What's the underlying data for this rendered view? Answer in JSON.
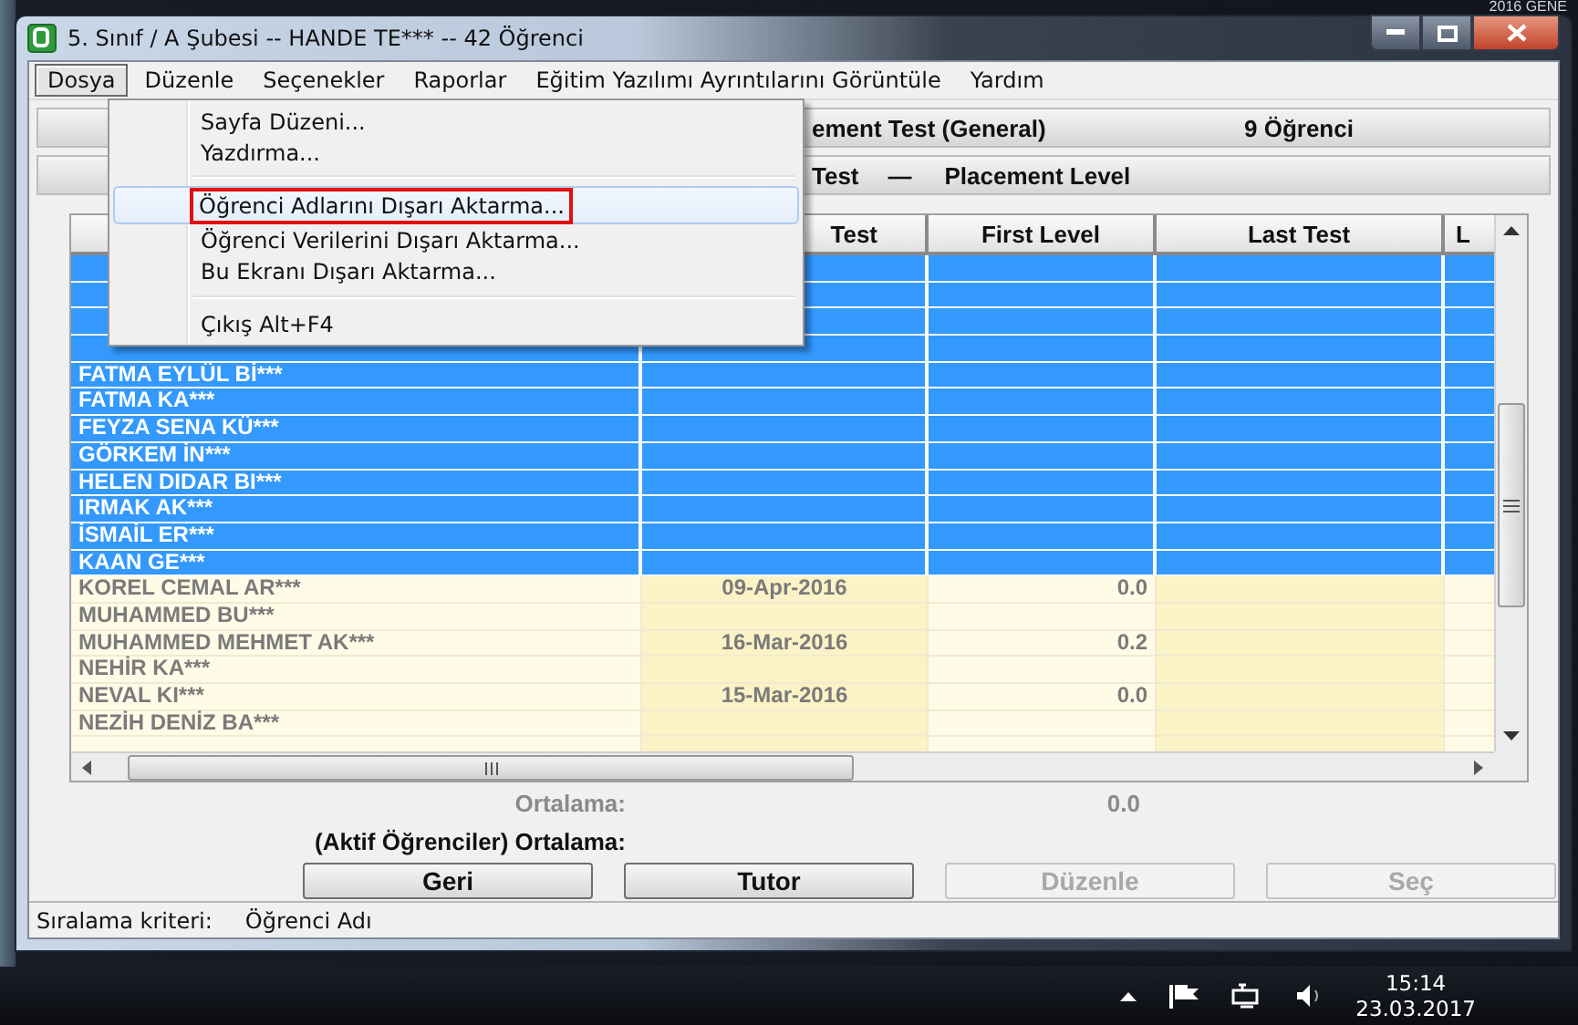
{
  "desktop": {
    "corner_text": "2016 GENE"
  },
  "window": {
    "title": "5. Sınıf / A Şubesi -- HANDE TE*** -- 42 Öğrenci"
  },
  "menu_bar": [
    {
      "label": "Dosya",
      "selected": true
    },
    {
      "label": "Düzenle",
      "selected": false
    },
    {
      "label": "Seçenekler",
      "selected": false
    },
    {
      "label": "Raporlar",
      "selected": false
    },
    {
      "label": "Eğitim Yazılımı Ayrıntılarını Görüntüle",
      "selected": false
    },
    {
      "label": "Yardım",
      "selected": false
    }
  ],
  "menu": [
    {
      "kind": "item",
      "label": "Sayfa Düzeni...",
      "highlighted": false
    },
    {
      "kind": "item",
      "label": "Yazdırma...",
      "highlighted": false
    },
    {
      "kind": "separator"
    },
    {
      "kind": "item",
      "label": "Öğrenci Adlarını Dışarı Aktarma...",
      "highlighted": true
    },
    {
      "kind": "item",
      "label": "Öğrenci Verilerini Dışarı Aktarma...",
      "highlighted": false
    },
    {
      "kind": "item",
      "label": "Bu Ekranı Dışarı Aktarma...",
      "highlighted": false
    },
    {
      "kind": "separator"
    },
    {
      "kind": "item",
      "label": "Çıkış",
      "shortcut": "Alt+F4",
      "highlighted": false
    }
  ],
  "test_bar": {
    "test": "ement Test (General)",
    "count": "9 Öğrenci"
  },
  "level_bar": {
    "left": "Test",
    "dash": "—",
    "right": "Placement Level"
  },
  "table": {
    "columns": [
      "Test",
      "First Level",
      "Last Test",
      "L"
    ],
    "rows": [
      {
        "selected": true
      },
      {
        "selected": true
      },
      {
        "selected": true
      },
      {
        "selected": true
      },
      {
        "name": "FATMA EYLÜL Bİ***",
        "selected": true
      },
      {
        "name": "FATMA KA***",
        "selected": true
      },
      {
        "name": "FEYZA SENA KÜ***",
        "selected": true
      },
      {
        "name": "GÖRKEM İN***",
        "selected": true
      },
      {
        "name": "HELEN DIDAR BI***",
        "selected": true
      },
      {
        "name": "IRMAK AK***",
        "selected": true
      },
      {
        "name": "İSMAİL ER***",
        "selected": true
      },
      {
        "name": "KAAN GE***",
        "selected": true
      },
      {
        "name": "KOREL CEMAL AR***",
        "first_test": "09-Apr-2016",
        "first_level": "0.0",
        "selected": false
      },
      {
        "name": "MUHAMMED BU***",
        "selected": false
      },
      {
        "name": "MUHAMMED MEHMET AK***",
        "first_test": "16-Mar-2016",
        "first_level": "0.2",
        "selected": false
      },
      {
        "name": "NEHİR KA***",
        "selected": false
      },
      {
        "name": "NEVAL KI***",
        "first_test": "15-Mar-2016",
        "first_level": "0.0",
        "selected": false
      },
      {
        "name": "NEZİH DENİZ BA***",
        "selected": false
      },
      {
        "selected": false
      }
    ]
  },
  "summary": {
    "average_label": "Ortalama:",
    "average_value": "0.0",
    "active_label": "(Aktif Öğrenciler) Ortalama:"
  },
  "buttons": [
    {
      "label": "Geri",
      "disabled": false
    },
    {
      "label": "Tutor",
      "disabled": false
    },
    {
      "label": "Düzenle",
      "disabled": true
    },
    {
      "label": "Seç",
      "disabled": true
    }
  ],
  "status_bar": {
    "label": "Sıralama kriteri:",
    "value": "Öğrenci Adı"
  },
  "taskbar": {
    "time": "15:14",
    "date": "23.03.2017"
  }
}
